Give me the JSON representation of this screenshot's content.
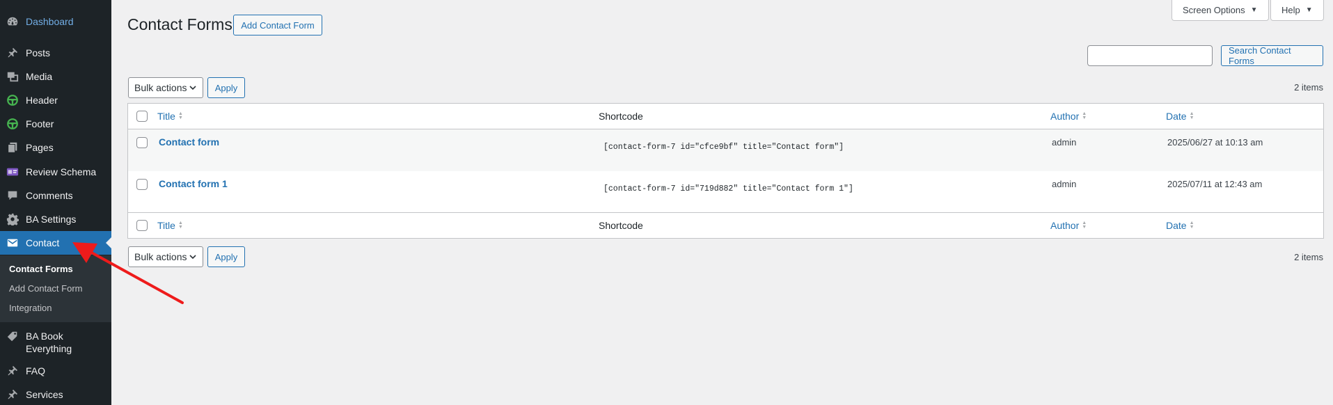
{
  "sidebar": {
    "items": [
      {
        "label": "Dashboard",
        "icon": "dashboard-icon"
      },
      {
        "label": "Posts",
        "icon": "pushpin-icon"
      },
      {
        "label": "Media",
        "icon": "media-icon"
      },
      {
        "label": "Header",
        "icon": "steering-wheel-icon"
      },
      {
        "label": "Footer",
        "icon": "steering-wheel-icon"
      },
      {
        "label": "Pages",
        "icon": "pages-icon"
      },
      {
        "label": "Review Schema",
        "icon": "review-schema-icon"
      },
      {
        "label": "Comments",
        "icon": "comment-icon"
      },
      {
        "label": "BA Settings",
        "icon": "gear-icon"
      },
      {
        "label": "Contact",
        "icon": "envelope-icon"
      },
      {
        "label": "BA Book Everything",
        "icon": "tag-icon"
      },
      {
        "label": "FAQ",
        "icon": "pushpin-icon"
      },
      {
        "label": "Services",
        "icon": "pushpin-icon"
      }
    ],
    "submenu": [
      "Contact Forms",
      "Add Contact Form",
      "Integration"
    ]
  },
  "header": {
    "screen_options": "Screen Options",
    "help": "Help",
    "title": "Contact Forms",
    "add_button": "Add Contact Form"
  },
  "search": {
    "button": "Search Contact Forms",
    "value": ""
  },
  "bulk": {
    "select": "Bulk actions",
    "apply": "Apply"
  },
  "items_count": "2 items",
  "table": {
    "columns": {
      "title": "Title",
      "shortcode": "Shortcode",
      "author": "Author",
      "date": "Date"
    },
    "rows": [
      {
        "title": "Contact form",
        "shortcode": "[contact-form-7 id=\"cfce9bf\" title=\"Contact form\"]",
        "author": "admin",
        "date": "2025/06/27 at 10:13 am"
      },
      {
        "title": "Contact form 1",
        "shortcode": "[contact-form-7 id=\"719d882\" title=\"Contact form 1\"]",
        "author": "admin",
        "date": "2025/07/11 at 12:43 am"
      }
    ]
  },
  "colors": {
    "accent": "#2271b1",
    "sidebar": "#1d2327",
    "arrow": "#ee1b1b"
  }
}
